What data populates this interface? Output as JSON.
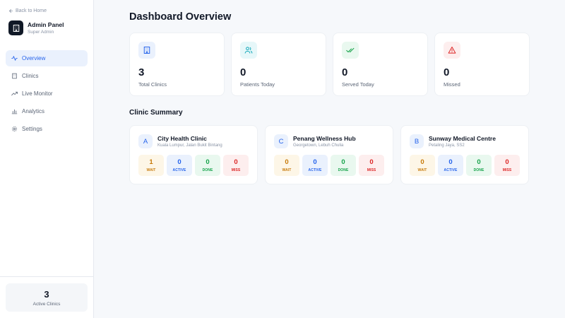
{
  "sidebar": {
    "back_label": "Back to Home",
    "brand_title": "Admin Panel",
    "brand_subtitle": "Super Admin",
    "items": [
      {
        "label": "Overview",
        "icon": "activity-icon",
        "active": true
      },
      {
        "label": "Clinics",
        "icon": "building-icon",
        "active": false
      },
      {
        "label": "Live Monitor",
        "icon": "trending-up-icon",
        "active": false
      },
      {
        "label": "Analytics",
        "icon": "bar-chart-icon",
        "active": false
      },
      {
        "label": "Settings",
        "icon": "gear-icon",
        "active": false
      }
    ],
    "active_clinics_value": "3",
    "active_clinics_label": "Active Clinics"
  },
  "main": {
    "title": "Dashboard Overview",
    "stats": [
      {
        "value": "3",
        "label": "Total Clinics",
        "icon": "building-icon",
        "color": "#2563eb",
        "bg": "#eaf1fd"
      },
      {
        "value": "0",
        "label": "Patients Today",
        "icon": "users-icon",
        "color": "#0ea5b7",
        "bg": "#e6f7f9"
      },
      {
        "value": "0",
        "label": "Served Today",
        "icon": "double-check-icon",
        "color": "#16a34a",
        "bg": "#e9f8ef"
      },
      {
        "value": "0",
        "label": "Missed",
        "icon": "alert-triangle-icon",
        "color": "#dc2626",
        "bg": "#fdeeee"
      }
    ],
    "summary_title": "Clinic Summary",
    "clinics": [
      {
        "initial": "A",
        "name": "City Health Clinic",
        "location": "Kuala Lumpur, Jalan Bukit Bintang",
        "wait": "1",
        "active": "0",
        "done": "0",
        "miss": "0"
      },
      {
        "initial": "C",
        "name": "Penang Wellness Hub",
        "location": "Georgetown, Lebuh Chulia",
        "wait": "0",
        "active": "0",
        "done": "0",
        "miss": "0"
      },
      {
        "initial": "B",
        "name": "Sunway Medical Centre",
        "location": "Petaling Jaya, SS2",
        "wait": "0",
        "active": "0",
        "done": "0",
        "miss": "0"
      }
    ],
    "metric_labels": {
      "wait": "WAIT",
      "active": "ACTIVE",
      "done": "DONE",
      "miss": "MISS"
    }
  }
}
